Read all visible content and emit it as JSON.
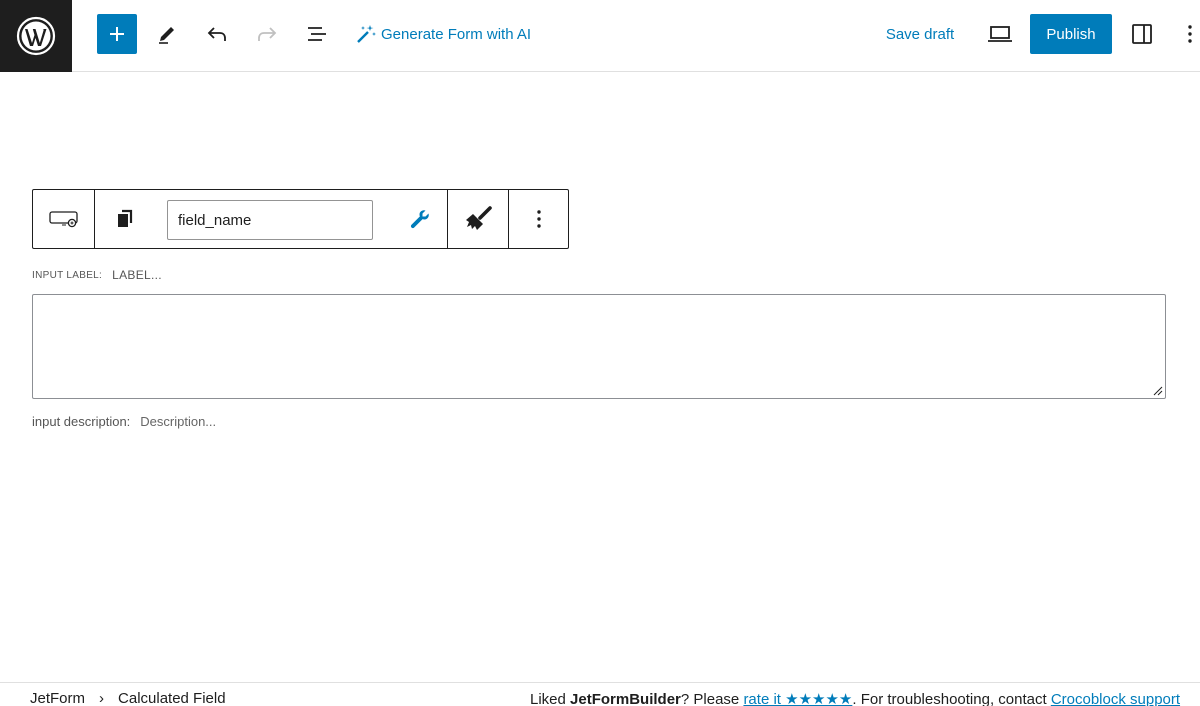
{
  "header": {
    "ai_label": "Generate Form with AI",
    "save_draft_label": "Save draft",
    "publish_label": "Publish"
  },
  "block_toolbar": {
    "field_name_value": "field_name"
  },
  "field": {
    "input_label_key": "INPUT LABEL:",
    "input_label_placeholder": "LABEL...",
    "description_key": "input description:",
    "description_placeholder": "Description..."
  },
  "footer": {
    "breadcrumb": [
      "JetForm",
      "Calculated Field"
    ],
    "breadcrumb_sep": "›",
    "note_prefix": "Liked ",
    "note_brand": "JetFormBuilder",
    "note_middle": "? Please ",
    "rate_link": "rate it ★★★★★",
    "note_suffix": ". For troubleshooting, contact ",
    "support_link": "Crocoblock support"
  },
  "colors": {
    "accent": "#007cba",
    "dark": "#1e1e1e"
  }
}
